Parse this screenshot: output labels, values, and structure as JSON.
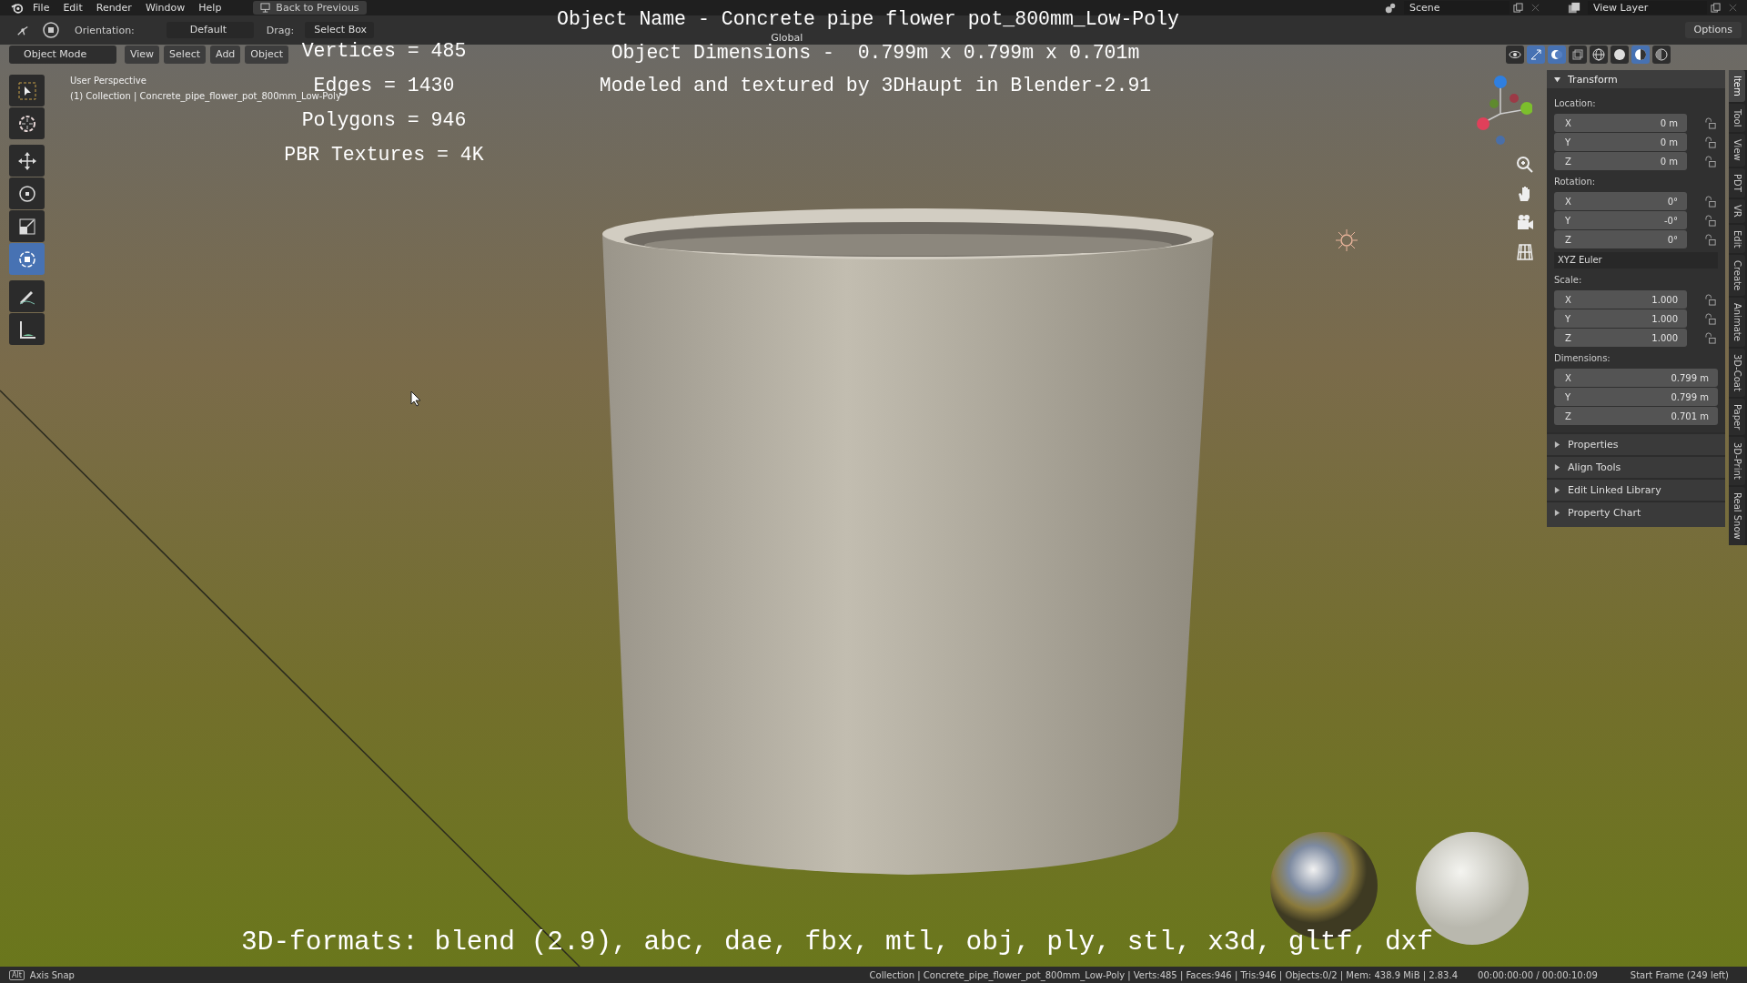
{
  "top_bar": {
    "menus": [
      "File",
      "Edit",
      "Render",
      "Window",
      "Help"
    ],
    "back_button": "Back to Previous",
    "scene": "Scene",
    "view_layer": "View Layer"
  },
  "tool_settings": {
    "orientation_label": "Orientation:",
    "orientation": "Default",
    "drag_label": "Drag:",
    "drag": "Select Box",
    "transform_orientation": "Global",
    "options": "Options"
  },
  "viewport_header": {
    "mode": "Object Mode",
    "menus": [
      "View",
      "Select",
      "Add",
      "Object"
    ],
    "toggles": [
      {
        "kind": "visibility",
        "selected": false
      },
      {
        "kind": "gizmo",
        "selected": true
      },
      {
        "kind": "overlay",
        "selected": true
      },
      {
        "kind": "xray",
        "selected": false
      },
      {
        "kind": "wireframe",
        "selected": false
      },
      {
        "kind": "solid",
        "selected": false
      },
      {
        "kind": "material",
        "selected": true
      },
      {
        "kind": "rendered",
        "selected": false
      }
    ]
  },
  "toolbar": [
    {
      "kind": "select",
      "selected": false
    },
    {
      "kind": "cursor",
      "selected": false
    },
    {
      "kind": "move",
      "selected": false
    },
    {
      "kind": "rotate",
      "selected": false
    },
    {
      "kind": "scale",
      "selected": false
    },
    {
      "kind": "transform",
      "selected": true
    },
    {
      "kind": "annotate",
      "selected": false
    },
    {
      "kind": "measure",
      "selected": false
    }
  ],
  "viewport": {
    "view_name": "User Perspective",
    "collection": "(1) Collection | Concrete_pipe_flower_pot_800mm_Low-Poly",
    "overlay": {
      "title": "Object Name - Concrete pipe flower pot_800mm_Low-Poly",
      "dimensions": "Object Dimensions -  0.799m x 0.799m x 0.701m",
      "credit": "Modeled and textured by 3DHaupt in Blender-2.91",
      "stats": [
        "Vertices = 485",
        "Edges = 1430",
        "Polygons = 946",
        "PBR Textures = 4K"
      ],
      "formats": "3D-formats: blend (2.9), abc, dae, fbx, mtl, obj, ply, stl, x3d, gltf, dxf"
    }
  },
  "sidebar": {
    "panel": "Transform",
    "expanded": true,
    "items": [
      {
        "kind": "group",
        "label": "Location:",
        "fields": [
          {
            "axis": "X",
            "value": "0 m",
            "locked": false
          },
          {
            "axis": "Y",
            "value": "0 m",
            "locked": false
          },
          {
            "axis": "Z",
            "value": "0 m",
            "locked": false
          }
        ]
      },
      {
        "kind": "group",
        "label": "Rotation:",
        "fields": [
          {
            "axis": "X",
            "value": "0°",
            "locked": false
          },
          {
            "axis": "Y",
            "value": "-0°",
            "locked": false
          },
          {
            "axis": "Z",
            "value": "0°",
            "locked": false
          }
        ]
      },
      {
        "kind": "dropdown",
        "value": "XYZ Euler"
      },
      {
        "kind": "group",
        "label": "Scale:",
        "fields": [
          {
            "axis": "X",
            "value": "1.000",
            "locked": false
          },
          {
            "axis": "Y",
            "value": "1.000",
            "locked": false
          },
          {
            "axis": "Z",
            "value": "1.000",
            "locked": false
          }
        ]
      },
      {
        "kind": "group",
        "label": "Dimensions:",
        "fields": [
          {
            "axis": "X",
            "value": "0.799 m"
          },
          {
            "axis": "Y",
            "value": "0.799 m"
          },
          {
            "axis": "Z",
            "value": "0.701 m"
          }
        ]
      }
    ],
    "collapsed_panels": [
      {
        "label": "Properties",
        "expanded": false
      },
      {
        "label": "Align Tools",
        "expanded": false
      },
      {
        "label": "Edit Linked Library",
        "expanded": false
      },
      {
        "label": "Property Chart",
        "expanded": false
      }
    ],
    "tabs": [
      {
        "label": "Item",
        "selected": true
      },
      {
        "label": "Tool",
        "selected": false
      },
      {
        "label": "View",
        "selected": false
      },
      {
        "label": "PDT",
        "selected": false
      },
      {
        "label": "VR",
        "selected": false
      },
      {
        "label": "Edit",
        "selected": false
      },
      {
        "label": "Create",
        "selected": false
      },
      {
        "label": "Animate",
        "selected": false
      },
      {
        "label": "3D-Coat",
        "selected": false
      },
      {
        "label": "Paper",
        "selected": false
      },
      {
        "label": "3D-Print",
        "selected": false
      },
      {
        "label": "Real Snow",
        "selected": false
      }
    ]
  },
  "status_bar": {
    "key": "Alt",
    "hint": "Axis Snap",
    "info": "Collection | Concrete_pipe_flower_pot_800mm_Low-Poly | Verts:485 | Faces:946 | Tris:946 | Objects:0/2 | Mem: 438.9 MiB | 2.83.4",
    "time": "00:00:00:00 / 00:00:10:09",
    "frame": "Start Frame (249 left)"
  }
}
